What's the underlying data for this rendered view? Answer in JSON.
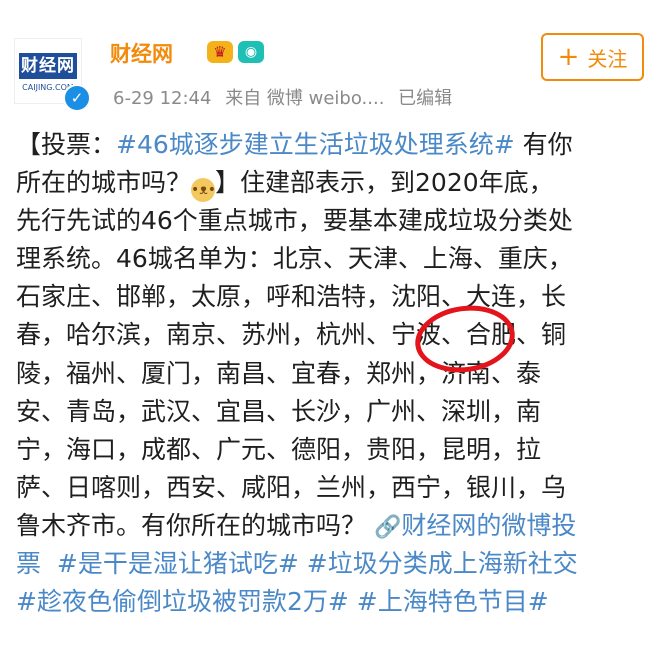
{
  "header": {
    "avatar_text": "财经网",
    "avatar_sub": "CAIJING.COM",
    "username": "财经网",
    "timestamp": "6-29 12:44",
    "source": "来自 微博 weibo....",
    "edited": "已编辑",
    "follow_label": "关注",
    "icons": [
      "verified-icon",
      "crown-badge-icon",
      "camera-badge-icon",
      "plus-icon"
    ]
  },
  "post": {
    "line1_a": "【投票：",
    "line1_tag": "#46城逐步建立生活垃圾处理系统#",
    "line1_b": " 有你",
    "line2_a": "所在的城市吗？",
    "line2_emoji": "dog-face-emoji",
    "line2_b": "】住建部表示，到2020年底，",
    "line3": "先行先试的46个重点城市，要基本建成垃圾分类处",
    "line4": "理系统。46城名单为：北京、天津、上海、重庆，",
    "line5": "石家庄、邯郸，太原，呼和浩特，沈阳、大连，长",
    "line6": "春，哈尔滨，南京、苏州，杭州、宁波、合肥、铜",
    "line7": "陵，福州、厦门，南昌、宜春，郑州，济南、泰",
    "line8": "安、青岛，武汉、宜昌、长沙，广州、深圳，南",
    "line9": "宁，海口，成都、广元、德阳，贵阳，昆明，拉",
    "line10": "萨、日喀则，西安、咸阳，兰州，西宁，银川，乌",
    "line11_a": "鲁木齐市。有你所在的城市吗？ ",
    "line11_link": "财经网的微博投",
    "line12_link": "票",
    "line12_tag1": "#是干是湿让猪试吃#",
    "line12_tag2": "#垃圾分类成上海新社交",
    "line13_tag1": "#趁夜色偷倒垃圾被罚款2万#",
    "line13_tag2": "#上海特色节目#"
  },
  "colors": {
    "accent_orange": "#f28a0c",
    "link_blue": "#4a88c7",
    "annotation_red": "#e3141b"
  }
}
